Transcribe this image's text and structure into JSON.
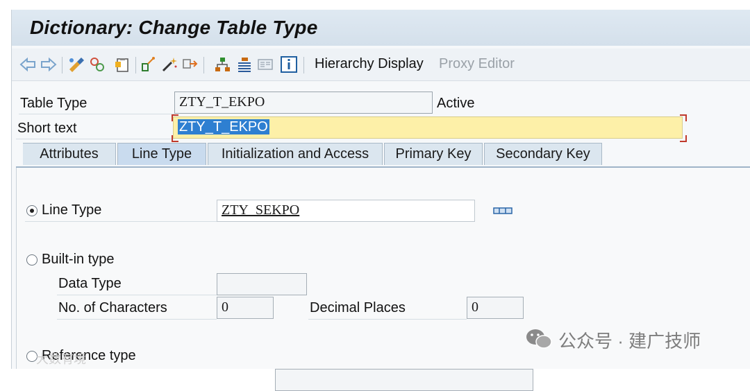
{
  "window": {
    "title": "Dictionary: Change Table Type"
  },
  "toolbar": {
    "icons": [
      "back-icon",
      "forward-icon",
      "other-object-icon",
      "display-change-icon",
      "activate-icon",
      "check-icon",
      "where-used-icon",
      "object-list-icon",
      "navigation-window-icon",
      "hierarchy-icon",
      "information-icon"
    ],
    "hierarchy_display": "Hierarchy Display",
    "proxy_editor": "Proxy Editor"
  },
  "header": {
    "table_type_label": "Table Type",
    "table_type_value": "ZTY_T_EKPO",
    "status": "Active",
    "short_text_label": "Short text",
    "short_text_value": "ZTY_T_EKPO"
  },
  "tabs": [
    {
      "label": "Attributes"
    },
    {
      "label": "Line Type"
    },
    {
      "label": "Initialization and Access"
    },
    {
      "label": "Primary Key"
    },
    {
      "label": "Secondary Key"
    }
  ],
  "line_type_tab": {
    "line_type_radio_label": "Line Type",
    "line_type_value": "ZTY_SEKPO",
    "builtin_radio_label": "Built-in type",
    "data_type_label": "Data Type",
    "data_type_value": "",
    "no_chars_label": "No. of Characters",
    "no_chars_value": "0",
    "decimal_label": "Decimal Places",
    "decimal_value": "0",
    "reference_radio_label": "Reference type"
  },
  "watermark": {
    "main": "公众号 · 建广技师",
    "left": "大数有境"
  },
  "colors": {
    "accent": "#2e7fd1",
    "highlight": "#fdf0a8",
    "tab_active": "#c9dbee"
  }
}
